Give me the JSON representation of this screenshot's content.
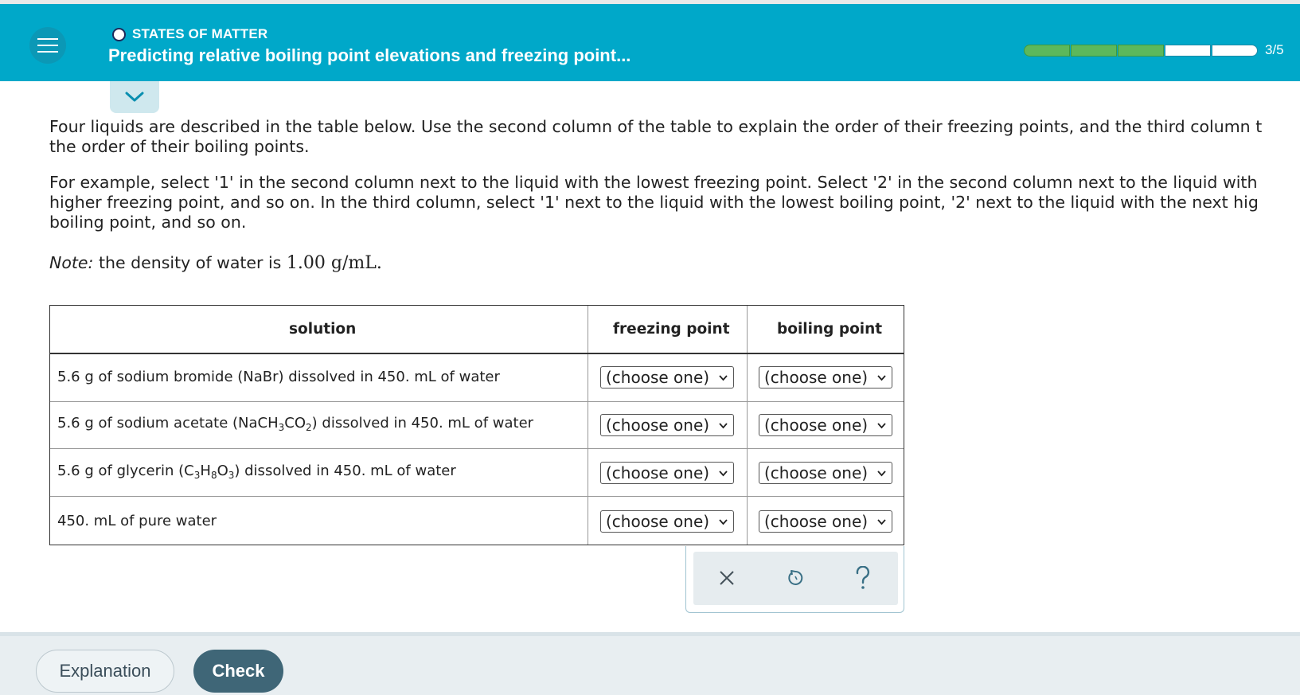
{
  "header": {
    "topic": "STATES OF MATTER",
    "title": "Predicting relative boiling point elevations and freezing point...",
    "progress": {
      "completed": 3,
      "total": 5,
      "label": "3/5"
    }
  },
  "question": {
    "line1": "Four liquids are described in the table below. Use the second column of the table to explain the order of their freezing points, and the third column t",
    "line2": "the order of their boiling points.",
    "line3": "For example, select '1' in the second column next to the liquid with the lowest freezing point. Select '2' in the second column next to the liquid with",
    "line4": "higher freezing point, and so on. In the third column, select '1' next to the liquid with the lowest boiling point, '2' next to the liquid with the next hig",
    "line5": "boiling point, and so on.",
    "note_label": "Note:",
    "note_text": " the density of water is ",
    "note_value": "1.00 g/mL."
  },
  "table": {
    "headers": {
      "solution": "solution",
      "freezing": "freezing point",
      "boiling": "boiling point"
    },
    "select_placeholder": "(choose one)",
    "rows": [
      {
        "a": "5.6 g of sodium bromide (NaBr) dissolved in 450. mL of water"
      },
      {
        "a": "5.6 g of sodium acetate (NaCH",
        "s1": "3",
        "b": "CO",
        "s2": "2",
        "c": ") dissolved in 450. mL of water"
      },
      {
        "a": "5.6 g of glycerin (C",
        "s1": "3",
        "b": "H",
        "s2": "8",
        "c": "O",
        "s3": "3",
        "d": ") dissolved in 450. mL of water"
      },
      {
        "a": "450. mL of pure water"
      }
    ]
  },
  "footer": {
    "explanation": "Explanation",
    "check": "Check"
  },
  "colors": {
    "header_bg": "#00a8c9",
    "progress_fill": "#5cb85c",
    "check_bg": "#3f6677"
  }
}
